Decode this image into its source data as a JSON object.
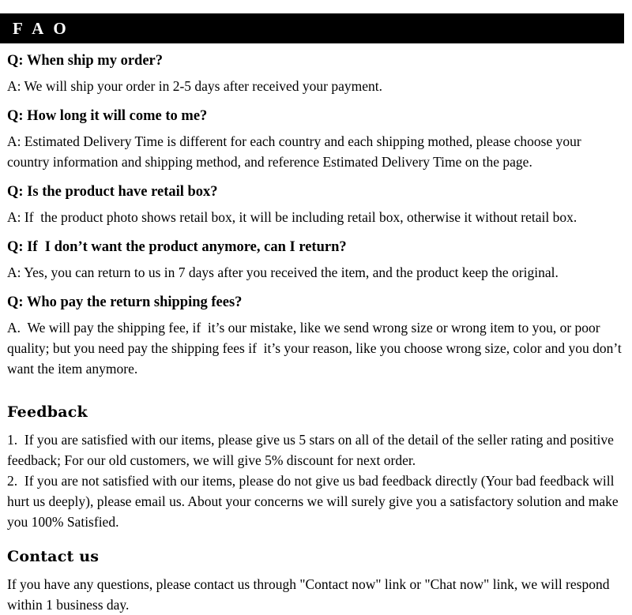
{
  "banner": {
    "title": "F A O",
    "background_color": "#000000",
    "text_color": "#ffffff"
  },
  "faq": {
    "items": [
      {
        "question": "Q: When ship my order?",
        "answer": "A: We will ship your order in 2-5 days after received your payment."
      },
      {
        "question": "Q: How long it will come to me?",
        "answer": "A: Estimated Delivery Time is different for each country and each shipping mothed, please choose your country information and shipping method, and reference Estimated Delivery Time on the page."
      },
      {
        "question": "Q: Is the product have retail box?",
        "answer": "A: If  the product photo shows retail box, it will be including retail box, otherwise it without retail box."
      },
      {
        "question": "Q: If  I don’t want the product anymore, can I return?",
        "answer": "A: Yes, you can return to us in 7 days after you received the item, and the product keep the original."
      },
      {
        "question": "Q: Who pay the return shipping fees?",
        "answer": "A.  We will pay the shipping fee, if  it’s our mistake, like we send wrong size or wrong item to you, or poor quality; but you need pay the shipping fees if  it’s your reason, like you choose wrong size, color and you don’t want the item anymore."
      }
    ]
  },
  "feedback": {
    "heading": "Feedback",
    "items": [
      "1.  If you are satisfied with our items, please give us 5 stars on all of the detail of the seller rating and positive feedback; For our old customers, we will give 5% discount for next order.",
      "2.  If you are not satisfied with our items, please do not give us bad feedback directly (Your bad feedback will hurt us deeply), please email us. About your concerns we will surely give you a satisfactory solution and make you 100% Satisfied."
    ]
  },
  "contact": {
    "heading": "Contact us",
    "body": "If you have any questions, please contact us through \"Contact now\" link or \"Chat now\" link, we will respond within 1 business day."
  }
}
